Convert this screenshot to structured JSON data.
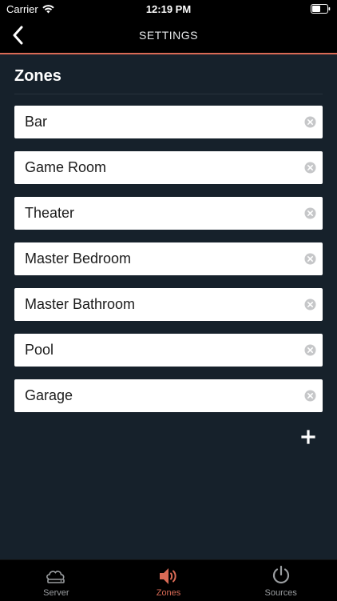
{
  "status_bar": {
    "carrier": "Carrier",
    "time": "12:19 PM",
    "icons": [
      "wifi-icon",
      "battery-icon"
    ]
  },
  "nav": {
    "title": "SETTINGS",
    "back_icon": "chevron-left-icon"
  },
  "zones": {
    "title": "Zones",
    "items": [
      {
        "name": "Bar"
      },
      {
        "name": "Game Room"
      },
      {
        "name": "Theater"
      },
      {
        "name": "Master Bedroom"
      },
      {
        "name": "Master Bathroom"
      },
      {
        "name": "Pool"
      },
      {
        "name": "Garage"
      }
    ],
    "add_icon": "plus-icon",
    "clear_icon": "clear-circle-icon"
  },
  "tab_bar": {
    "tabs": [
      {
        "label": "Server",
        "icon": "server-icon",
        "active": false
      },
      {
        "label": "Zones",
        "icon": "speaker-icon",
        "active": true
      },
      {
        "label": "Sources",
        "icon": "power-icon",
        "active": false
      }
    ]
  },
  "colors": {
    "background": "#16212b",
    "bar": "#000000",
    "accent": "#d96a55",
    "inactive_tab": "#9a9da0"
  }
}
